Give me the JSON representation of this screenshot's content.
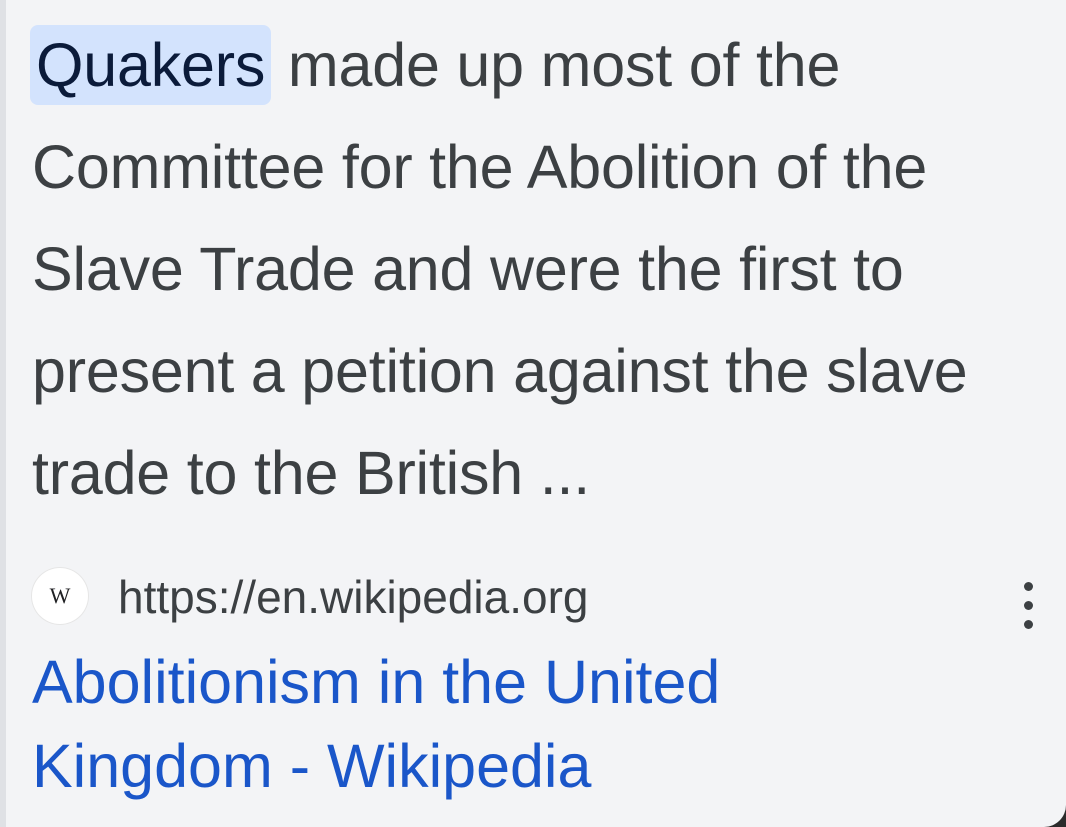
{
  "snippet": {
    "highlight": "Quakers",
    "text": " made up most of the Committee for the Abolition of the Slave Trade and were the first to present a petition against the slave trade to the British ..."
  },
  "result": {
    "favicon_letter": "W",
    "url": "https://en.wikipedia.org",
    "title_line1": "Abolitionism in the United",
    "title_line2": "Kingdom - Wikipedia",
    "menu_icon": "more-vert-icon"
  },
  "colors": {
    "link": "#1a56c9",
    "highlight_bg": "#d3e3fd",
    "text": "#3c4043",
    "card_bg": "#f3f4f6"
  }
}
